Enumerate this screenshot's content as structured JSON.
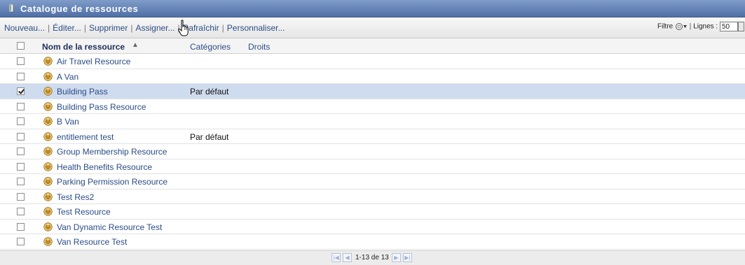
{
  "window": {
    "title": "Catalogue de ressources"
  },
  "toolbar": {
    "actions": [
      "Nouveau...",
      "Éditer...",
      "Supprimer",
      "Assigner...",
      "Rafraîchir",
      "Personnaliser..."
    ],
    "filter_label": "Filtre",
    "rows_label": "Lignes :",
    "rows_value": "50"
  },
  "table": {
    "columns": {
      "name": "Nom de la ressource",
      "categories": "Catégories",
      "rights": "Droits"
    },
    "sort_indicator": "▲",
    "rows": [
      {
        "name": "Air Travel Resource",
        "category": "",
        "checked": false,
        "selected": false
      },
      {
        "name": "A Van",
        "category": "",
        "checked": false,
        "selected": false
      },
      {
        "name": "Building Pass",
        "category": "Par défaut",
        "checked": true,
        "selected": true
      },
      {
        "name": "Building Pass Resource",
        "category": "",
        "checked": false,
        "selected": false
      },
      {
        "name": "B Van",
        "category": "",
        "checked": false,
        "selected": false
      },
      {
        "name": "entitlement test",
        "category": "Par défaut",
        "checked": false,
        "selected": false
      },
      {
        "name": "Group Membership Resource",
        "category": "",
        "checked": false,
        "selected": false
      },
      {
        "name": "Health Benefits Resource",
        "category": "",
        "checked": false,
        "selected": false
      },
      {
        "name": "Parking Permission Resource",
        "category": "",
        "checked": false,
        "selected": false
      },
      {
        "name": "Test Res2",
        "category": "",
        "checked": false,
        "selected": false
      },
      {
        "name": "Test Resource",
        "category": "",
        "checked": false,
        "selected": false
      },
      {
        "name": "Van Dynamic Resource Test",
        "category": "",
        "checked": false,
        "selected": false
      },
      {
        "name": "Van Resource Test",
        "category": "",
        "checked": false,
        "selected": false
      }
    ]
  },
  "pager": {
    "text": "1-13 de 13"
  },
  "colors": {
    "title_bg": "#5a78ad",
    "link": "#2b4c86",
    "selected_row": "#cfdcef"
  }
}
